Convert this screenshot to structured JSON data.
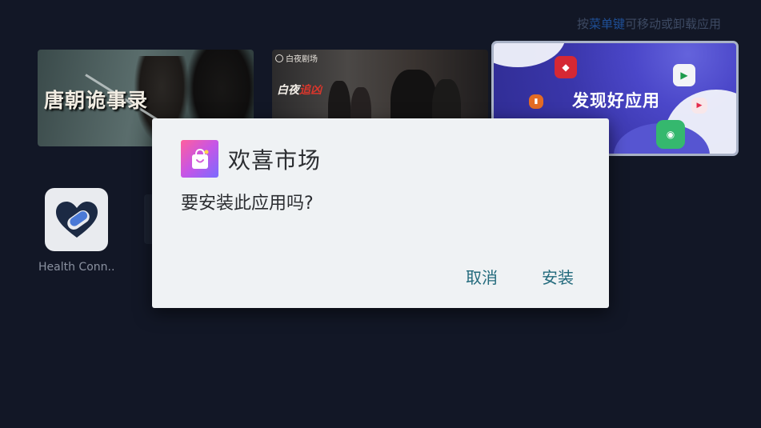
{
  "hint": {
    "prefix": "按",
    "key": "菜单键",
    "suffix": "可移动或卸载应用"
  },
  "banners": [
    {
      "title": "唐朝诡事录"
    },
    {
      "brand": "白夜剧场",
      "title_a": "白夜",
      "title_b": "追凶"
    },
    {
      "title": "发现好应用"
    }
  ],
  "apps": [
    {
      "label": "Health Conn.."
    }
  ],
  "dialog": {
    "app_name": "欢喜市场",
    "message": "要安装此应用吗?",
    "cancel_label": "取消",
    "install_label": "安装"
  },
  "colors": {
    "background": "#121726",
    "dialog_background": "#eff2f4",
    "button_text": "#226a7c",
    "focus_border": "#a9b2c6"
  },
  "icons": {
    "app_store": "shopping-bag-icon",
    "health_connect": "health-connect-icon"
  }
}
